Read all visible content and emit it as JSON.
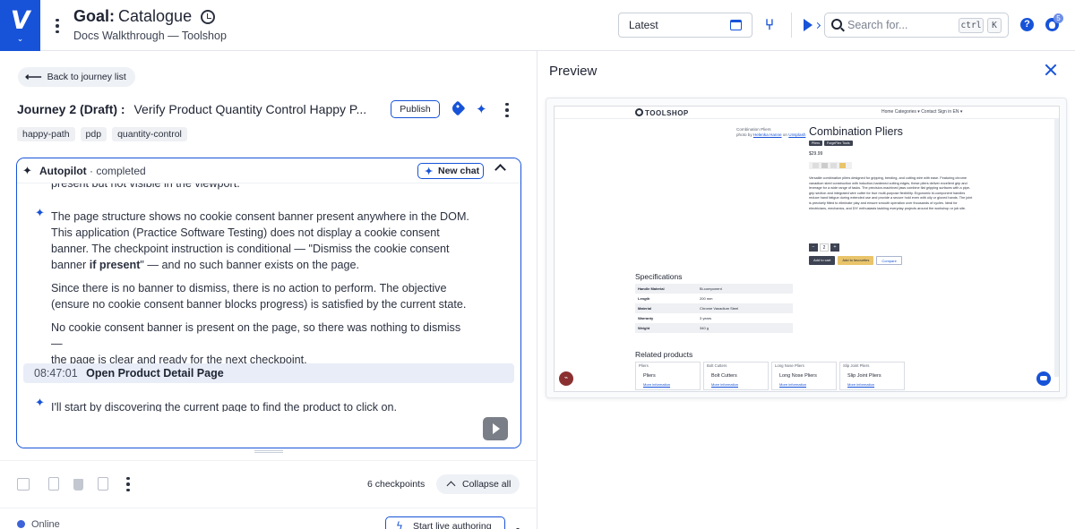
{
  "header": {
    "goal_prefix": "Goal:",
    "goal_name": "Catalogue",
    "subtitle": "Docs Walkthrough — Toolshop",
    "version": "Latest",
    "search_placeholder": "Search for...",
    "kbd_ctrl": "ctrl",
    "kbd_k": "K",
    "help_label": "?",
    "notification_count": "5"
  },
  "left": {
    "back_label": "Back to journey list",
    "journey_prefix": "Journey 2 (Draft) :",
    "journey_name": "Verify Product Quantity Control Happy P...",
    "publish_label": "Publish",
    "tags": [
      "happy-path",
      "pdp",
      "quantity-control"
    ],
    "autopilot": {
      "title": "Autopilot",
      "status": "· completed",
      "new_chat_label": "New chat",
      "messages": {
        "m0": "present but not visible in the viewport.",
        "m1_line1": "The page structure shows no cookie consent banner present anywhere in the DOM.",
        "m1_line2": "This application (Practice Software Testing) does not display a cookie consent",
        "m1_line3": "banner. The checkpoint instruction is conditional — \"Dismiss the cookie consent",
        "m1_line4_a": "banner ",
        "m1_line4_b": "if present",
        "m1_line4_c": "\" — and no such banner exists on the page.",
        "m2_line1": "Since there is no banner to dismiss, there is no action to perform. The objective",
        "m2_line2": "(ensure no cookie consent banner blocks progress) is satisfied by the current state.",
        "m3_line1": "No cookie consent banner is present on the page, so there was nothing to dismiss —",
        "m3_line2": "the page is clear and ready for the next checkpoint.",
        "checkpoint_time": "08:47:01",
        "checkpoint_name": "Open Product Detail Page",
        "m4": "I'll start by discovering the current page to find the product to click on."
      }
    },
    "toolbar": {
      "checkpoints_count": "6 checkpoints",
      "collapse_all_label": "Collapse all"
    },
    "status": {
      "online_label": "Online",
      "live_authoring_label": "Start live authoring"
    }
  },
  "preview": {
    "title": "Preview",
    "site": {
      "logo": "TOOLSHOP",
      "nav": "Home   Categories ▾   Contact   Sign in   EN ▾",
      "image_caption": "Combination Pliers",
      "photo_by": "photo by",
      "photo_credit": "Helenka Hanne",
      "photo_on": "on",
      "photo_site": "Unsplash",
      "product_title": "Combination Pliers",
      "badge_1": "Pliers",
      "badge_2": "ForgeFlex Tools",
      "price": "$29.99",
      "description": "Versatile combination pliers designed for gripping, bending, and cutting wire with ease. Featuring chrome vanadium steel construction with induction-hardened cutting edges, these pliers deliver excellent grip and leverage for a wide range of tasks. The precision-machined jaws combine flat gripping surfaces with a pipe-grip section and integrated wire cutter for true multi-purpose flexibility. Ergonomic bi-component handles reduce hand fatigue during extended use and provide a secure hold even with oily or gloved hands. The joint is precisely fitted to eliminate play and ensure smooth operation over thousands of cycles. Ideal for electricians, mechanics, and DIY enthusiasts tackling everyday projects around the workshop or job site.",
      "qty_minus": "−",
      "qty_value": "2",
      "qty_plus": "+",
      "add_to_cart": "Add to cart",
      "add_to_favourites": "Add to favourites",
      "compare": "Compare",
      "specs_title": "Specifications",
      "specs": [
        {
          "k": "Handle Material",
          "v": "Bi-component"
        },
        {
          "k": "Length",
          "v": "200 mm"
        },
        {
          "k": "Material",
          "v": "Chrome Vanadium Steel"
        },
        {
          "k": "Warranty",
          "v": "3 years"
        },
        {
          "k": "Weight",
          "v": "340 g"
        }
      ],
      "related_title": "Related products",
      "related": [
        {
          "img": "Pliers",
          "name": "Pliers",
          "more": "More information"
        },
        {
          "img": "Bolt Cutters",
          "name": "Bolt Cutters",
          "more": "More information"
        },
        {
          "img": "Long Nose Pliers",
          "name": "Long Nose Pliers",
          "more": "More information"
        },
        {
          "img": "Slip Joint Pliers",
          "name": "Slip Joint Pliers",
          "more": "More information"
        }
      ]
    }
  },
  "colors": {
    "brand": "#1753d8",
    "highlight_row": "#e8edf8",
    "online": "#3d63d8"
  },
  "icons": {
    "logo": "virtuoso-v-logo",
    "history": "history-icon",
    "calendar": "calendar-icon",
    "branch": "branch-icon",
    "run": "run-icon",
    "search": "search-icon",
    "help": "help-icon",
    "notifications": "bell-icon",
    "sparkle": "sparkle-icon",
    "tag": "tag-icon",
    "close": "close-icon"
  }
}
